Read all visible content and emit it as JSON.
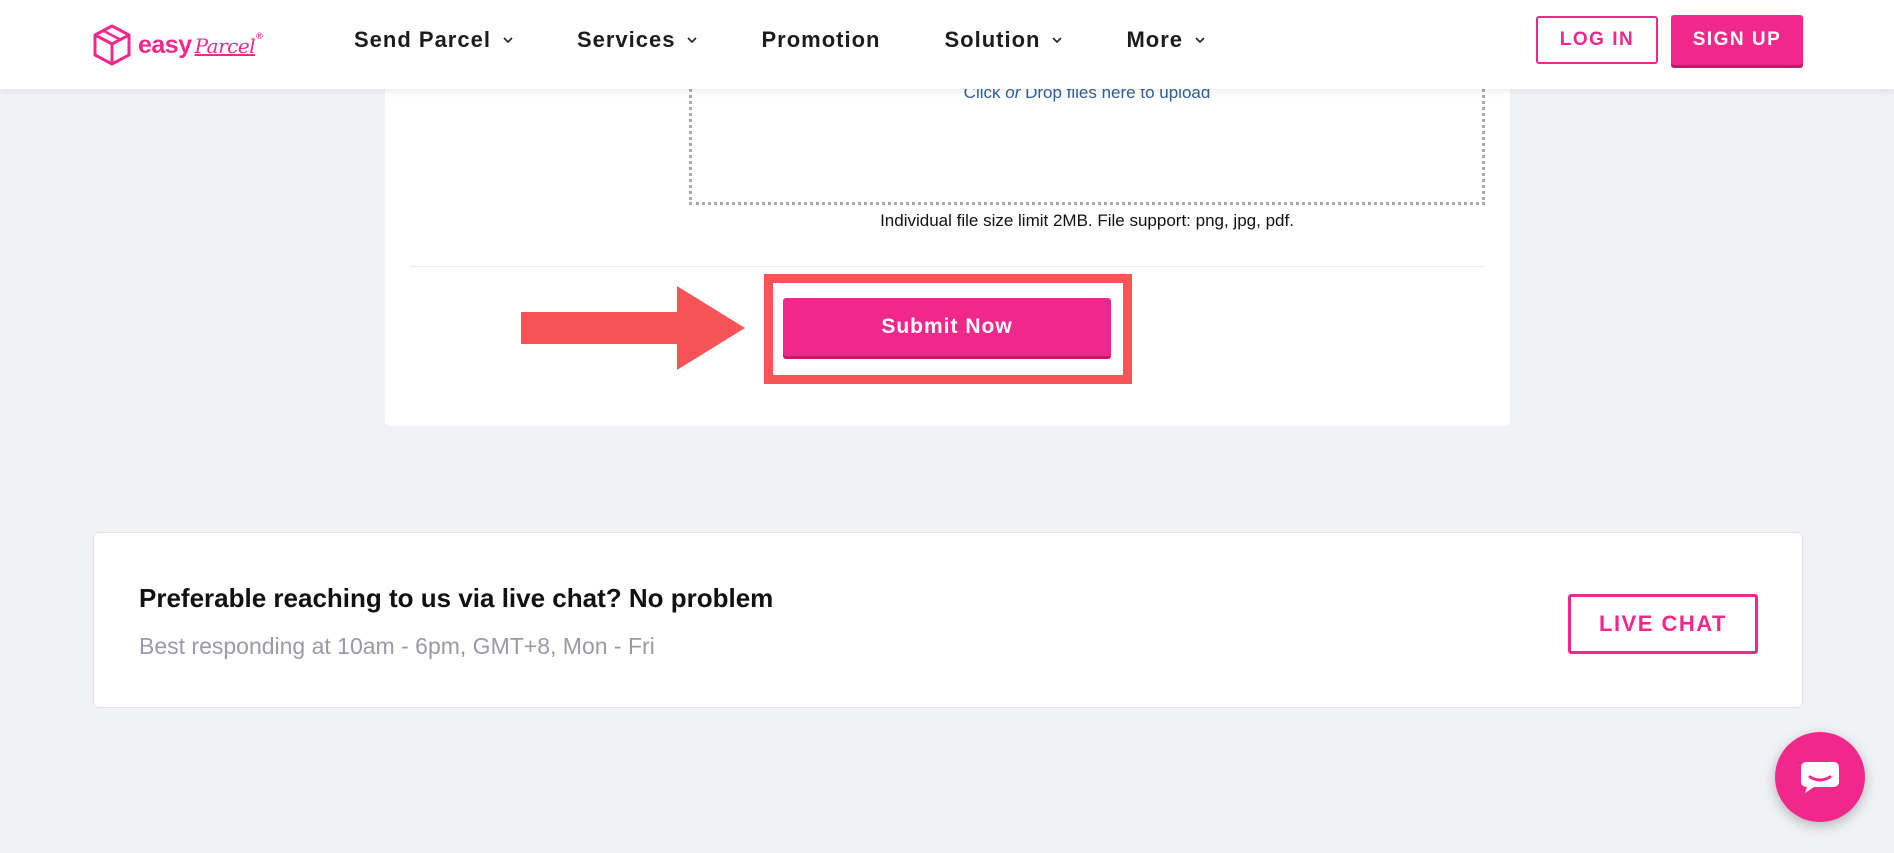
{
  "brand": {
    "word": "easy",
    "script": "Parcel",
    "mark": "®"
  },
  "nav": {
    "items": [
      {
        "label": "Send Parcel",
        "has_dropdown": true
      },
      {
        "label": "Services",
        "has_dropdown": true
      },
      {
        "label": "Promotion",
        "has_dropdown": false
      },
      {
        "label": "Solution",
        "has_dropdown": true
      },
      {
        "label": "More",
        "has_dropdown": true
      }
    ],
    "login_label": "LOG IN",
    "signup_label": "SIGN UP"
  },
  "upload": {
    "prefix": "Click ",
    "or": "or",
    "suffix": " Drop files here to upload",
    "limit_text": "Individual file size limit 2MB. File support: png, jpg, pdf."
  },
  "form": {
    "submit_label": "Submit Now"
  },
  "live_chat": {
    "title": "Preferable reaching to us via live chat? No problem",
    "subtitle": "Best responding at 10am - 6pm, GMT+8, Mon - Fri",
    "button_label": "LIVE CHAT"
  },
  "colors": {
    "brand": "#f0288c",
    "highlight": "#f85458",
    "background": "#f1f2f6"
  },
  "icons": {
    "logo": "box-icon",
    "dropdown": "chevron-down-icon",
    "chat_fab": "chat-bubble-icon",
    "annotation": "arrow-right-icon"
  }
}
